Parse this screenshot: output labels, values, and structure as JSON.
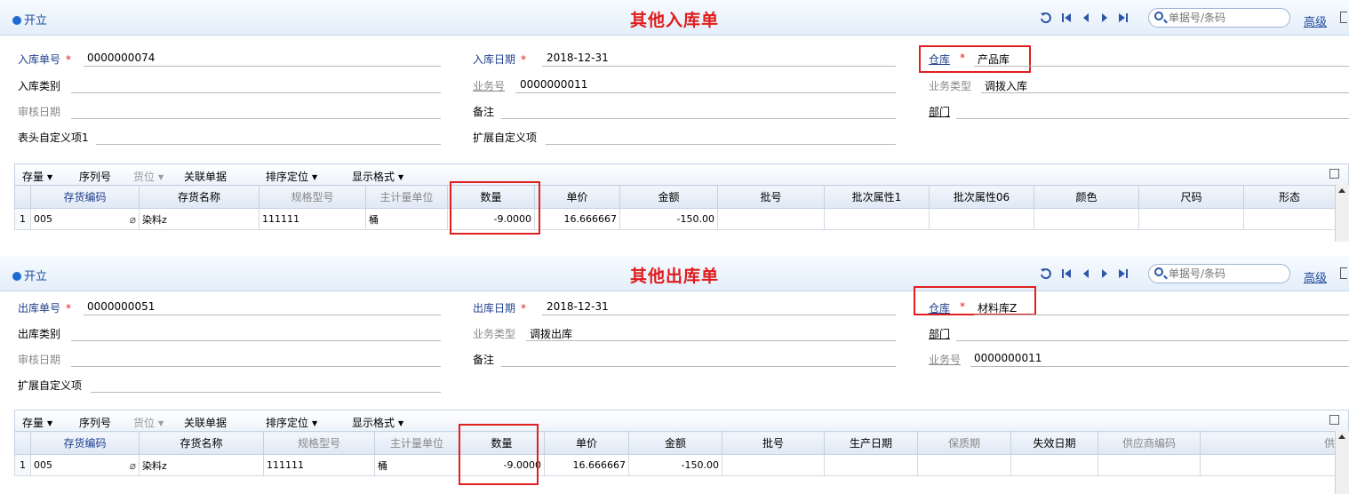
{
  "common": {
    "open_label": "开立",
    "advanced_label": "高级",
    "search_placeholder": "单据号/条码",
    "nav_icons": [
      "refresh-icon",
      "first-icon",
      "prev-icon",
      "next-icon",
      "last-icon"
    ],
    "toolbar": {
      "stock": "存量",
      "serial": "序列号",
      "location": "货位",
      "related": "关联单据",
      "sort": "排序定位",
      "display": "显示格式"
    }
  },
  "inbound": {
    "title": "其他入库单",
    "fields": {
      "doc_no_label": "入库单号",
      "doc_no": "0000000074",
      "date_label": "入库日期",
      "date": "2018-12-31",
      "warehouse_label": "仓库",
      "warehouse": "产品库",
      "category_label": "入库类别",
      "business_no_label": "业务号",
      "business_no": "0000000011",
      "business_type_label": "业务类型",
      "business_type": "调拨入库",
      "audit_date_label": "审核日期",
      "remark_label": "备注",
      "department_label": "部门",
      "header_custom_label": "表头自定义项1",
      "ext_custom_label": "扩展自定义项"
    },
    "grid": {
      "columns": [
        "存货编码",
        "存货名称",
        "规格型号",
        "主计量单位",
        "数量",
        "单价",
        "金额",
        "批号",
        "批次属性1",
        "批次属性06",
        "颜色",
        "尺码",
        "形态"
      ],
      "rows": [
        [
          "1",
          "005",
          "染料z",
          "111111",
          "桶",
          "-9.0000",
          "16.666667",
          "-150.00",
          "",
          "",
          "",
          "",
          "",
          ""
        ]
      ]
    }
  },
  "outbound": {
    "title": "其他出库单",
    "fields": {
      "doc_no_label": "出库单号",
      "doc_no": "0000000051",
      "date_label": "出库日期",
      "date": "2018-12-31",
      "warehouse_label": "仓库",
      "warehouse": "材料库Z",
      "category_label": "出库类别",
      "business_type_label": "业务类型",
      "business_type": "调拨出库",
      "department_label": "部门",
      "audit_date_label": "审核日期",
      "remark_label": "备注",
      "business_no_label": "业务号",
      "business_no": "0000000011",
      "ext_custom_label": "扩展自定义项"
    },
    "grid": {
      "columns": [
        "存货编码",
        "存货名称",
        "规格型号",
        "主计量单位",
        "数量",
        "单价",
        "金额",
        "批号",
        "生产日期",
        "保质期",
        "失效日期",
        "供应商编码",
        "供"
      ],
      "rows": [
        [
          "1",
          "005",
          "染料z",
          "111111",
          "桶",
          "-9.0000",
          "16.666667",
          "-150.00",
          "",
          "",
          "",
          "",
          "",
          ""
        ]
      ]
    }
  }
}
